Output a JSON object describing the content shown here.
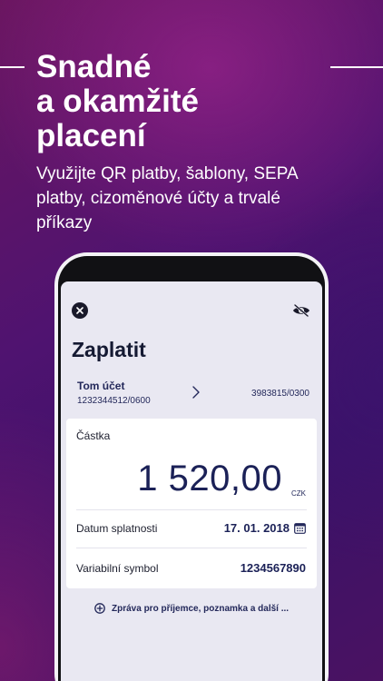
{
  "promo": {
    "headline_lines": [
      "Snadné",
      "a okamžité",
      "placení"
    ],
    "subtitle": "Využijte QR platby, šablony, SEPA platby, cizoměnové účty a trvalé příkazy"
  },
  "app": {
    "title": "Zaplatit",
    "account": {
      "name": "Tom účet",
      "number": "1232344512/0600",
      "target": "3983815/0300"
    },
    "payment": {
      "amount_label": "Částka",
      "amount": "1 520,00",
      "currency": "CZK",
      "due_date_label": "Datum splatnosti",
      "due_date": "17. 01. 2018",
      "variable_symbol_label": "Variabilní symbol",
      "variable_symbol": "1234567890"
    },
    "more_options": "Zpráva pro příjemce, poznamka a další ..."
  },
  "icons": {
    "close": "close-icon",
    "privacy": "eye-off-icon",
    "arrow": "chevron-right-icon",
    "calendar": "calendar-icon",
    "add": "plus-circle-icon"
  },
  "colors": {
    "accent": "#1b2157",
    "background_top": "#6a1660",
    "background_bottom": "#3a1168",
    "screen_bg": "#e9e8f2"
  }
}
